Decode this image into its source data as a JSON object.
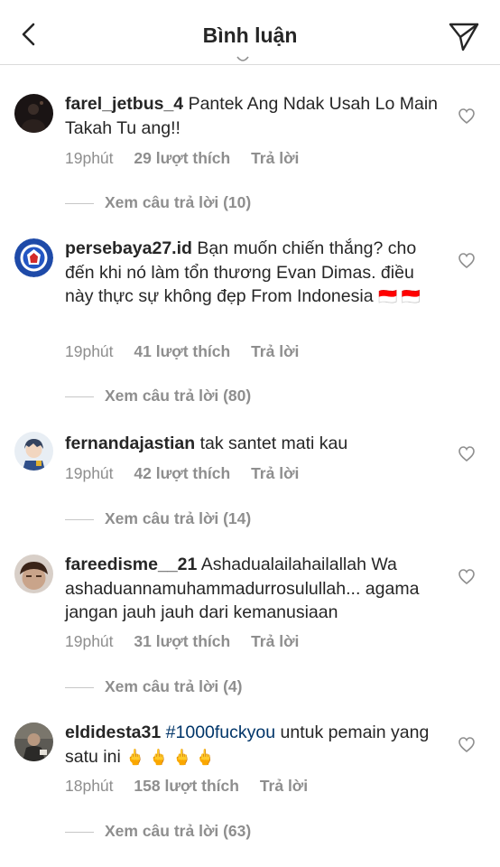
{
  "header": {
    "title": "Bình luận"
  },
  "comments": [
    {
      "username": "farel_jetbus_4",
      "text": "Pantek Ang Ndak Usah Lo Main Takah Tu ang!!",
      "time": "19phút",
      "likes": "29 lượt thích",
      "reply": "Trả lời",
      "view_replies": "Xem câu trả lời (10)"
    },
    {
      "username": "persebaya27.id",
      "text": "Bạn muốn chiến thắng? cho đến khi nó làm tổn thương Evan Dimas.  điều này thực sự không đẹp From Indonesia",
      "flags": "🇮🇩 🇮🇩",
      "time": "19phút",
      "likes": "41 lượt thích",
      "reply": "Trả lời",
      "view_replies": "Xem câu trả lời (80)"
    },
    {
      "username": "fernandajastian",
      "text": "tak santet mati kau",
      "time": "19phút",
      "likes": "42 lượt thích",
      "reply": "Trả lời",
      "view_replies": "Xem câu trả lời (14)"
    },
    {
      "username": "fareedisme__21",
      "text": "Ashadualailahailallah Wa ashaduannamuhammadurrosulullah... agama jangan jauh jauh dari kemanusiaan",
      "time": "19phút",
      "likes": "31 lượt thích",
      "reply": "Trả lời",
      "view_replies": "Xem câu trả lời (4)"
    },
    {
      "username": "eldidesta31",
      "hashtag": "#1000fuckyou",
      "text": "untuk pemain yang satu ini",
      "emojis": "🖕 🖕 🖕 🖕",
      "time": "18phút",
      "likes": "158 lượt thích",
      "reply": "Trả lời",
      "view_replies": "Xem câu trả lời (63)"
    }
  ]
}
